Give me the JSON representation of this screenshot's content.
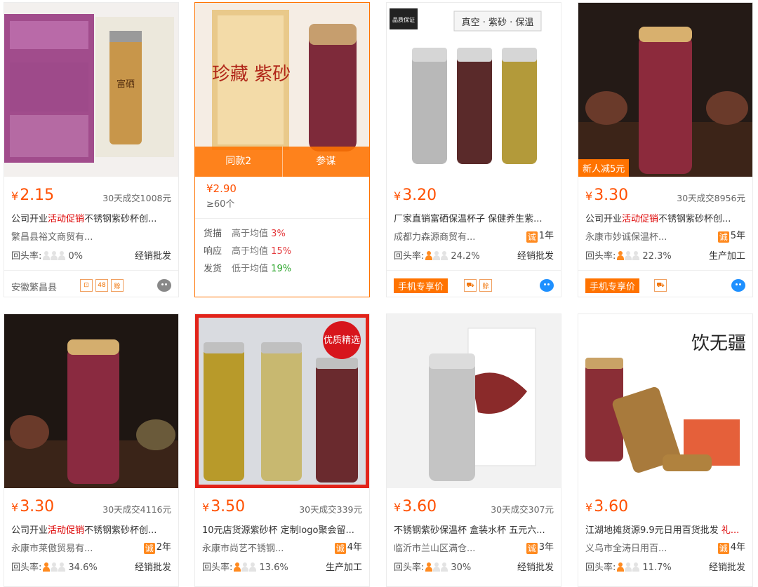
{
  "cards": [
    {
      "price": "2.15",
      "deal": "30天成交1008元",
      "title_pre": "公司开业",
      "title_hl": "活动促销",
      "title_post": "不锈钢紫砂杯创...",
      "shop": "繁昌县裕文商贸有...",
      "years": "",
      "repeat_label": "回头率:",
      "repeat": "0%",
      "persons_on": 0,
      "ptype": "经销批发",
      "region": "安徽繁昌县",
      "icons": [
        "⊡",
        "48",
        "赊"
      ],
      "ww": "gray"
    },
    {
      "active": true,
      "overlay_left": "同款2",
      "overlay_right": "参谋",
      "price": "2.90",
      "moq": "≥60个",
      "metrics": [
        {
          "label": "货描",
          "cmp": "高于均值",
          "value": "3%",
          "color": "red"
        },
        {
          "label": "响应",
          "cmp": "高于均值",
          "value": "15%",
          "color": "red"
        },
        {
          "label": "发货",
          "cmp": "低于均值",
          "value": "19%",
          "color": "green"
        }
      ]
    },
    {
      "price": "3.20",
      "deal": "",
      "title_pre": "厂家直销富硒保温杯子 保健养生紫...",
      "title_hl": "",
      "title_post": "",
      "shop": "成都力森源商贸有...",
      "years": "1年",
      "repeat_label": "回头率:",
      "repeat": "24.2%",
      "persons_on": 1,
      "ptype": "经销批发",
      "mobile_tag": "手机专享价",
      "icons": [
        "⛟",
        "赊"
      ],
      "ww": "blue"
    },
    {
      "price": "3.30",
      "deal": "30天成交8956元",
      "new_tag": "新人减5元",
      "title_pre": "公司开业",
      "title_hl": "活动促销",
      "title_post": "不锈钢紫砂杯创...",
      "shop": "永康市妙诚保温杯...",
      "years": "5年",
      "repeat_label": "回头率:",
      "repeat": "22.3%",
      "persons_on": 1,
      "ptype": "生产加工",
      "mobile_tag": "手机专享价",
      "icons": [
        "⛟"
      ],
      "ww": "blue"
    },
    {
      "price": "3.30",
      "deal": "30天成交4116元",
      "title_pre": "公司开业",
      "title_hl": "活动促销",
      "title_post": "不锈钢紫砂杯创...",
      "shop": "永康市莱傲贸易有...",
      "years": "2年",
      "repeat_label": "回头率:",
      "repeat": "34.6%",
      "persons_on": 1,
      "ptype": "经销批发"
    },
    {
      "price": "3.50",
      "deal": "30天成交339元",
      "quality": "优质精选",
      "title_pre": "10元店货源紫砂杯 定制logo聚会留...",
      "title_hl": "",
      "title_post": "",
      "shop": "永康市尚艺不锈钢...",
      "years": "4年",
      "repeat_label": "回头率:",
      "repeat": "13.6%",
      "persons_on": 1,
      "ptype": "生产加工"
    },
    {
      "price": "3.60",
      "deal": "30天成交307元",
      "title_pre": "不锈钢紫砂保温杯 盒装水杯 五元六...",
      "title_hl": "",
      "title_post": "",
      "shop": "临沂市兰山区满仓...",
      "years": "3年",
      "repeat_label": "回头率:",
      "repeat": "30%",
      "persons_on": 1,
      "ptype": "经销批发"
    },
    {
      "price": "3.60",
      "deal": "",
      "title_pre": "江湖地摊货源9.9元日用百货批发 ",
      "title_hl": "礼...",
      "title_post": "",
      "shop": "义乌市全涛日用百...",
      "years": "4年",
      "repeat_label": "回头率:",
      "repeat": "11.7%",
      "persons_on": 1,
      "ptype": "经销批发"
    }
  ],
  "image_text": {
    "c1_box": "富硒",
    "c2_box": "珍藏 紫砂",
    "c3_banner": "真空 · 紫砂 · 保温",
    "c3_seal": "品质保证",
    "c8_calli": "饮无疆"
  },
  "currency": "¥",
  "colors": {
    "accent": "#ff7300",
    "price": "#ff5000",
    "highlight": "#dd0000"
  }
}
